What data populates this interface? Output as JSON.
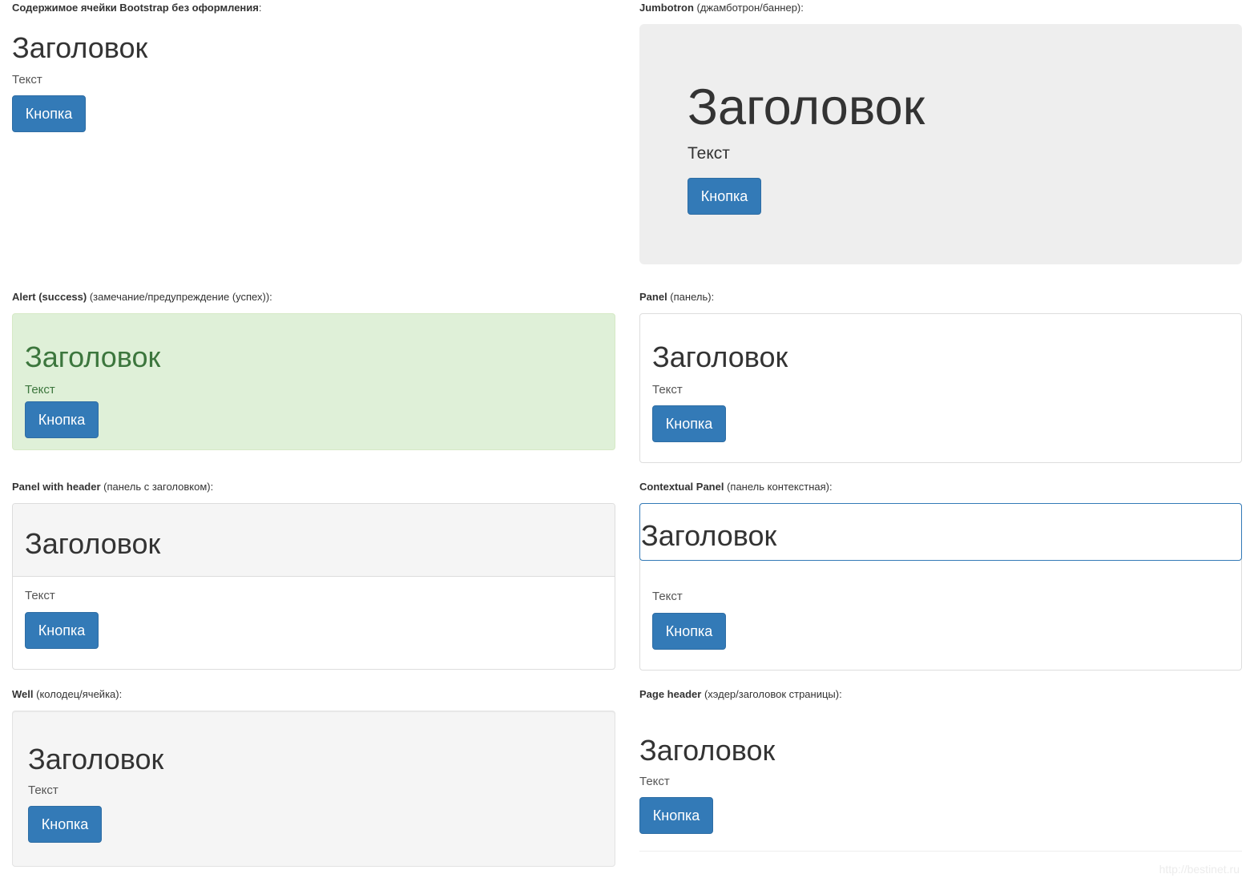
{
  "captions": {
    "plain": {
      "bold": "Содержимое ячейки Bootstrap без оформления",
      "rest": ":"
    },
    "jumbotron": {
      "bold": "Jumbotron",
      "rest": " (джамботрон/баннер):"
    },
    "alert": {
      "bold": "Alert (success)",
      "rest": " (замечание/предупреждение (успех)):"
    },
    "panel": {
      "bold": "Panel",
      "rest": " (панель):"
    },
    "panel_header": {
      "bold": "Panel with header",
      "rest": " (панель с заголовком):"
    },
    "contextual_panel": {
      "bold": "Contextual Panel",
      "rest": " (панель контекстная):"
    },
    "well": {
      "bold": "Well",
      "rest": " (колодец/ячейка):"
    },
    "page_header": {
      "bold": "Page header",
      "rest": " (хэдер/заголовок страницы):"
    }
  },
  "content": {
    "heading": "Заголовок",
    "text": "Текст",
    "button": "Кнопка"
  },
  "colors": {
    "primary_button": "#337ab7",
    "jumbotron_bg": "#eeeeee",
    "alert_success_bg": "#dff0d8",
    "alert_success_text": "#3c763d",
    "panel_border": "#dddddd",
    "panel_heading_bg": "#f5f5f5",
    "contextual_border": "#337ab7",
    "well_bg": "#f5f5f5"
  },
  "watermark": "http://bestinet.ru"
}
